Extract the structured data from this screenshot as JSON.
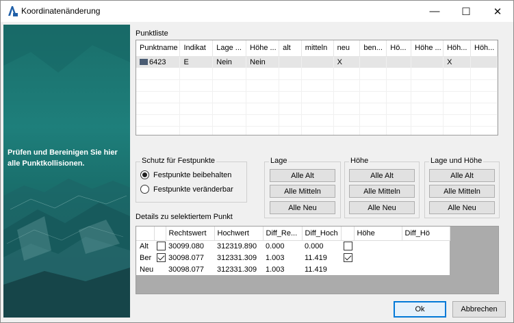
{
  "window": {
    "title": "Koordinatenänderung",
    "minimize_label": "—",
    "maximize_label": "☐",
    "close_label": "✕"
  },
  "banner": {
    "text": "Prüfen und Bereinigen Sie hier alle Punktkollisionen.",
    "help": "?"
  },
  "punktliste": {
    "label": "Punktliste",
    "columns": [
      "Punktname",
      "Indikat",
      "Lage ...",
      "Höhe ...",
      "alt",
      "mitteln",
      "neu",
      "ben...",
      "Hö...",
      "Höhe ...",
      "Höh...",
      "Höh..."
    ],
    "rows": [
      [
        "6423",
        "E",
        "Nein",
        "Nein",
        "",
        "",
        "X",
        "",
        "",
        "",
        "X",
        ""
      ]
    ]
  },
  "schutz": {
    "title": "Schutz für Festpunkte",
    "options": [
      {
        "label": "Festpunkte beibehalten",
        "selected": true
      },
      {
        "label": "Festpunkte veränderbar",
        "selected": false
      }
    ]
  },
  "groups": [
    {
      "title": "Lage",
      "buttons": [
        "Alle Alt",
        "Alle Mitteln",
        "Alle Neu"
      ]
    },
    {
      "title": "Höhe",
      "buttons": [
        "Alle Alt",
        "Alle Mitteln",
        "Alle Neu"
      ]
    },
    {
      "title": "Lage und Höhe",
      "buttons": [
        "Alle Alt",
        "Alle Mitteln",
        "Alle Neu"
      ]
    }
  ],
  "details": {
    "label": "Details zu selektiertem Punkt",
    "columns": [
      "",
      "",
      "Rechtswert",
      "Hochwert",
      "Diff_Re...",
      "Diff_Hoch",
      "",
      "Höhe",
      "Diff_Hö"
    ],
    "rows": [
      {
        "name": "Alt",
        "check1": false,
        "rechts": "30099.080",
        "hoch": "312319.890",
        "diff_re": "0.000",
        "diff_hoch": "0.000",
        "check2": false,
        "hoehe": "",
        "diff_hoe": ""
      },
      {
        "name": "Ber",
        "check1": true,
        "rechts": "30098.077",
        "hoch": "312331.309",
        "diff_re": "1.003",
        "diff_hoch": "11.419",
        "check2": true,
        "hoehe": "",
        "diff_hoe": ""
      },
      {
        "name": "Neu",
        "check1": null,
        "rechts": "30098.077",
        "hoch": "312331.309",
        "diff_re": "1.003",
        "diff_hoch": "11.419",
        "check2": null,
        "hoehe": "",
        "diff_hoe": ""
      }
    ]
  },
  "footer": {
    "ok": "Ok",
    "cancel": "Abbrechen"
  }
}
